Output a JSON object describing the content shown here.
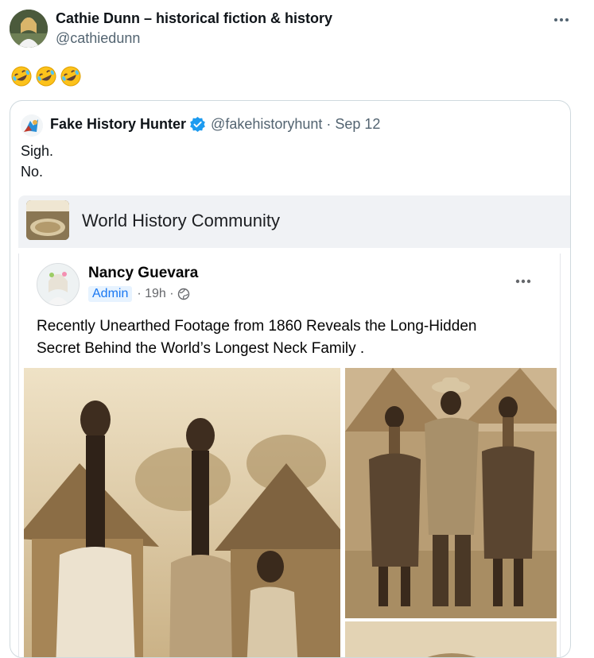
{
  "tweet": {
    "author_name": "Cathie Dunn – historical fiction & history",
    "author_handle": "@cathiedunn",
    "more_icon": "more-horizontal-icon",
    "emoji_icon": "rolling-on-floor-laughing-emoji",
    "emoji_count": 3
  },
  "quoted_tweet": {
    "author_name": "Fake History Hunter",
    "verified_icon": "verified-badge-icon",
    "author_handle": "@fakehistoryhunt",
    "separator": "·",
    "date": "Sep 12",
    "text_lines": [
      "Sigh.",
      "No."
    ]
  },
  "embedded_post": {
    "community_name": "World History Community",
    "community_thumb_text": "World History",
    "poster_name": "Nancy Guevara",
    "poster_role": "Admin",
    "poster_time": "· 19h ·",
    "privacy_icon": "globe-icon",
    "more_icon": "more-horizontal-icon",
    "text_lines": [
      "Recently Unearthed Footage from 1860 Reveals the Long-Hidden",
      "Secret Behind the World’s Longest Neck Family ."
    ]
  },
  "colors": {
    "text_primary": "#0f1419",
    "text_secondary": "#536471",
    "verified_blue": "#1d9bf0",
    "facebook_blue": "#1877f2",
    "card_border": "#cfd9de"
  }
}
